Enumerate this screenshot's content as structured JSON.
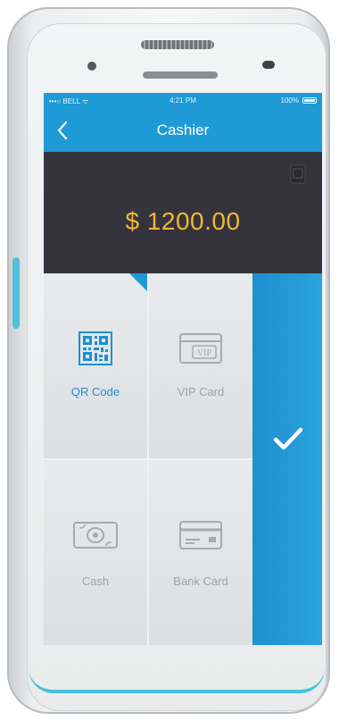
{
  "status_bar": {
    "carrier": "•••○ BELL ᯤ",
    "time": "4:21 PM",
    "battery": "100%"
  },
  "nav": {
    "back_icon": "chevron-left-icon",
    "title": "Cashier"
  },
  "amount": {
    "value": "$ 1200.00",
    "color": "#f3b634"
  },
  "payment_methods": [
    {
      "label": "QR Code",
      "icon": "qr-code-icon",
      "selected": true
    },
    {
      "label": "VIP Card",
      "icon": "vip-card-icon",
      "selected": false
    },
    {
      "label": "Cash",
      "icon": "cash-icon",
      "selected": false
    },
    {
      "label": "Bank Card",
      "icon": "bank-card-icon",
      "selected": false
    }
  ],
  "confirm": {
    "icon": "checkmark-icon"
  },
  "colors": {
    "primary": "#1e9ad6",
    "panel": "#35343d",
    "inactive_label": "#9da3a8"
  }
}
